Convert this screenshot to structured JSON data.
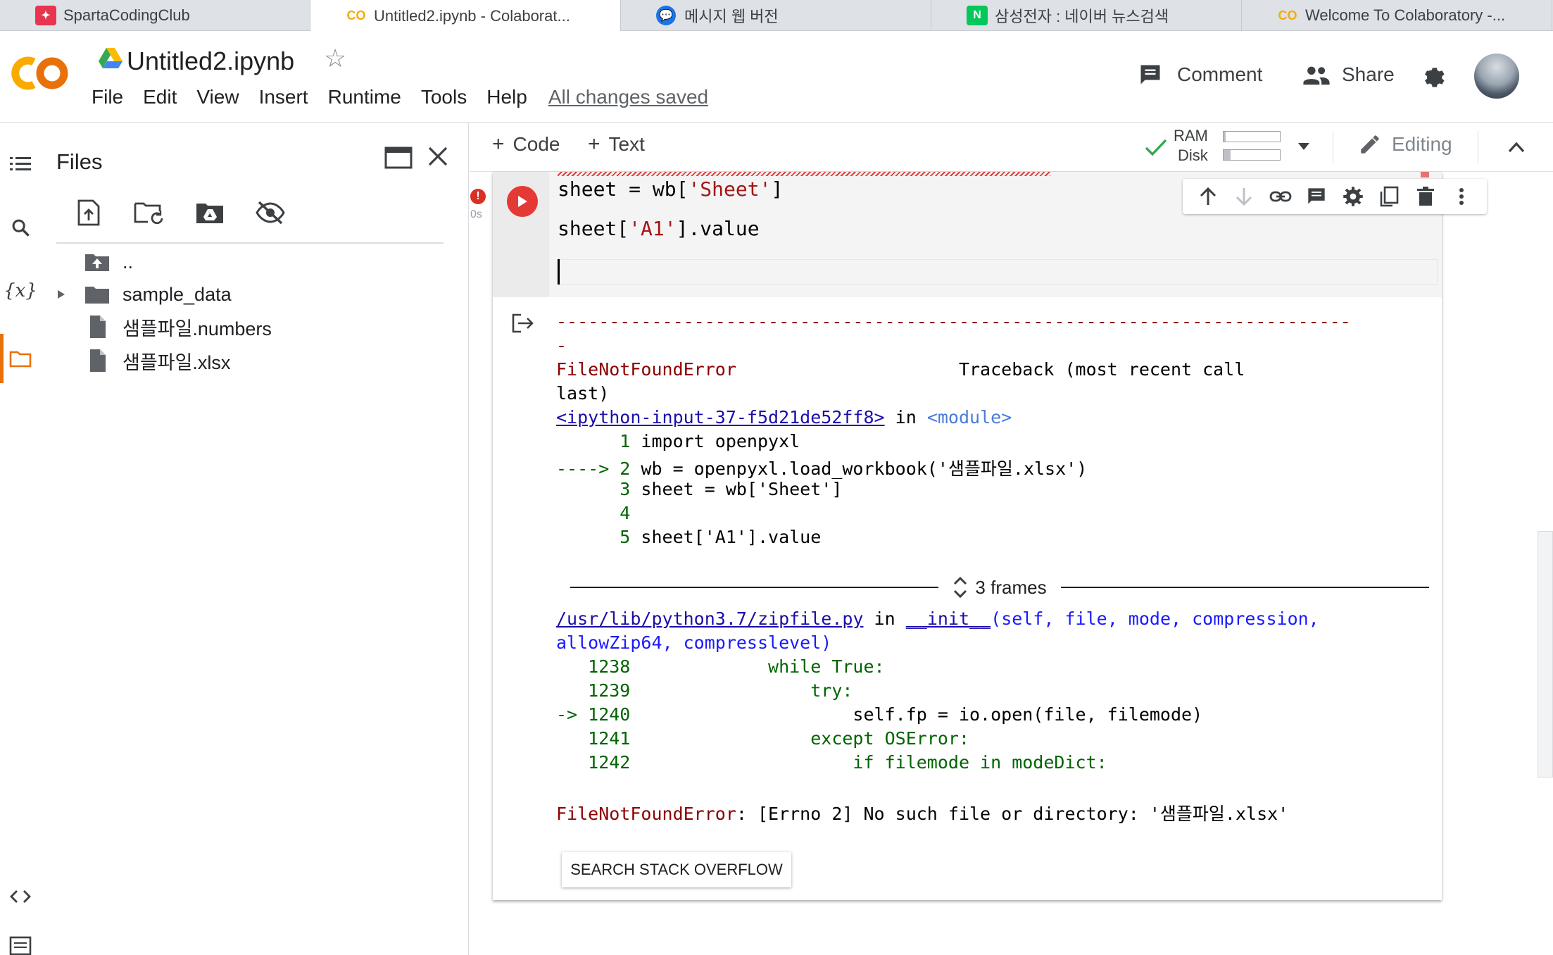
{
  "browser_tabs": [
    {
      "title": "SpartaCodingClub",
      "icon": "sparta-icon",
      "color": "#e8344e"
    },
    {
      "title": "Untitled2.ipynb - Colaborat...",
      "icon": "colab-icon",
      "color": "#f9ab00"
    },
    {
      "title": "메시지 웹 버전",
      "icon": "messages-icon",
      "color": "#1a73e8"
    },
    {
      "title": "삼성전자 : 네이버 뉴스검색",
      "icon": "naver-icon",
      "color": "#03c75a"
    },
    {
      "title": "Welcome To Colaboratory -...",
      "icon": "colab-icon",
      "color": "#f9ab00"
    }
  ],
  "header": {
    "title": "Untitled2.ipynb",
    "menu": [
      "File",
      "Edit",
      "View",
      "Insert",
      "Runtime",
      "Tools",
      "Help"
    ],
    "save_status": "All changes saved",
    "comment_label": "Comment",
    "share_label": "Share"
  },
  "rail": {
    "icons": [
      "toc-icon",
      "search-icon",
      "variables-icon",
      "folder-icon",
      "code-snippets-icon",
      "terminal-icon"
    ],
    "variables_glyph": "{x}"
  },
  "files": {
    "title": "Files",
    "tree": [
      {
        "name": "..",
        "type": "parent"
      },
      {
        "name": "sample_data",
        "type": "folder"
      },
      {
        "name": "샘플파일.numbers",
        "type": "file"
      },
      {
        "name": "샘플파일.xlsx",
        "type": "file"
      }
    ]
  },
  "toolbar": {
    "code_label": "Code",
    "text_label": "Text",
    "ram_label": "RAM",
    "disk_label": "Disk",
    "ram_fraction": 0.04,
    "disk_fraction": 0.12,
    "editing_label": "Editing"
  },
  "cell": {
    "exec_time": "0s",
    "code": {
      "line1_pre": "sheet = wb[",
      "line1_str": "'Sheet'",
      "line1_post": "]",
      "line2_pre": "sheet[",
      "line2_str": "'A1'",
      "line2_post": "].value"
    }
  },
  "output": {
    "dash_line": "---------------------------------------------------------------------------",
    "dash_tail": "-",
    "error_name": "FileNotFoundError",
    "traceback_header": "Traceback (most recent call",
    "traceback_tail": "last)",
    "input_link": "<ipython-input-37-f5d21de52ff8>",
    "in_word": "in",
    "module": "<module>",
    "src": [
      {
        "gutter": "      1",
        "code": " import openpyxl"
      },
      {
        "gutter": "----> 2",
        "code": " wb = openpyxl.load_workbook('샘플파일.xlsx')"
      },
      {
        "gutter": "      3",
        "code": " sheet = wb['Sheet']"
      },
      {
        "gutter": "      4",
        "code": ""
      },
      {
        "gutter": "      5",
        "code": " sheet['A1'].value"
      }
    ],
    "frames_label": "3 frames",
    "zip_link": "/usr/lib/python3.7/zipfile.py",
    "init_link": "__init__",
    "init_args": "(self, file, mode, compression,",
    "init_args2": "allowZip64, compresslevel)",
    "frame_lines": [
      {
        "gutter": "   1238",
        "code": "             while True:"
      },
      {
        "gutter": "   1239",
        "code": "                 try:"
      },
      {
        "gutter": "-> 1240",
        "code": "                     self.fp = io.open(file, filemode)"
      },
      {
        "gutter": "   1241",
        "code": "                 except OSError:"
      },
      {
        "gutter": "   1242",
        "code": "                     if filemode in modeDict:"
      }
    ],
    "final_error_name": "FileNotFoundError",
    "final_error_msg": ": [Errno 2] No such file or directory: '샘플파일.xlsx'",
    "so_button": "SEARCH STACK OVERFLOW"
  }
}
